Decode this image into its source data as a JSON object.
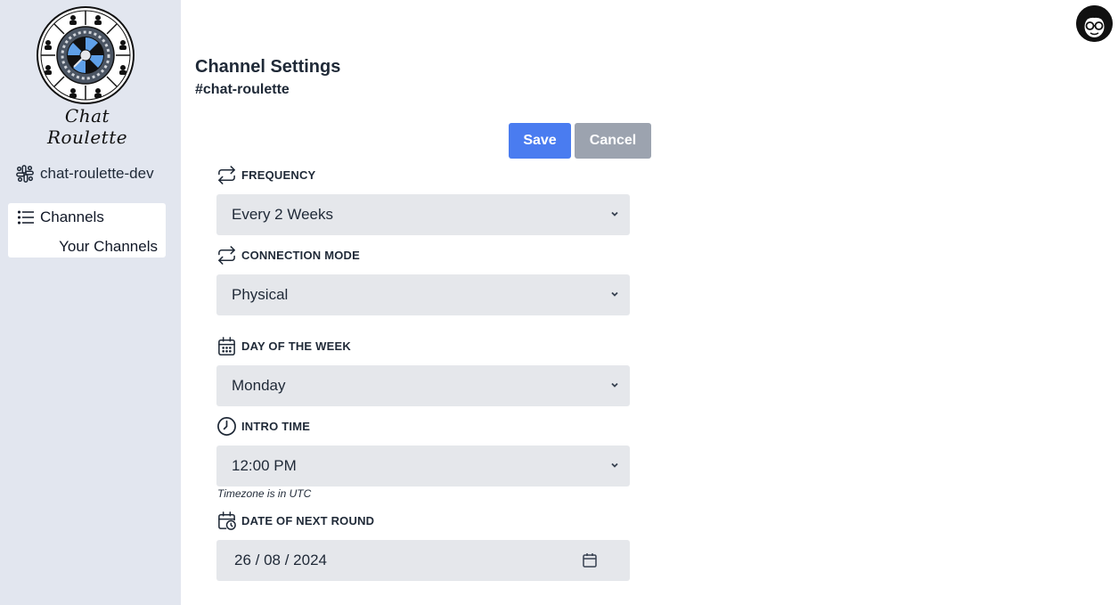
{
  "sidebar": {
    "logo_text": "Chat Roulette",
    "workspace": "chat-roulette-dev",
    "nav": {
      "channels_label": "Channels",
      "your_channels_label": "Your Channels"
    }
  },
  "header": {
    "title": "Channel Settings",
    "channel": "#chat-roulette"
  },
  "actions": {
    "save_label": "Save",
    "cancel_label": "Cancel"
  },
  "form": {
    "frequency": {
      "label": "FREQUENCY",
      "value": "Every 2 Weeks",
      "icon": "repeat-icon"
    },
    "connection_mode": {
      "label": "CONNECTION MODE",
      "value": "Physical",
      "icon": "repeat-icon"
    },
    "day_of_week": {
      "label": "DAY OF THE WEEK",
      "value": "Monday",
      "icon": "calendar-icon"
    },
    "intro_time": {
      "label": "INTRO TIME",
      "value": "12:00 PM",
      "hint": "Timezone is in UTC",
      "icon": "clock-icon"
    },
    "next_round": {
      "label": "DATE OF NEXT ROUND",
      "value": "26 / 08 / 2024",
      "icon": "calendar-clock-icon"
    }
  },
  "colors": {
    "sidebar_bg": "#e2e6ef",
    "primary": "#4a7cf0",
    "secondary": "#9ca3af",
    "field_bg": "#e5e7eb"
  }
}
